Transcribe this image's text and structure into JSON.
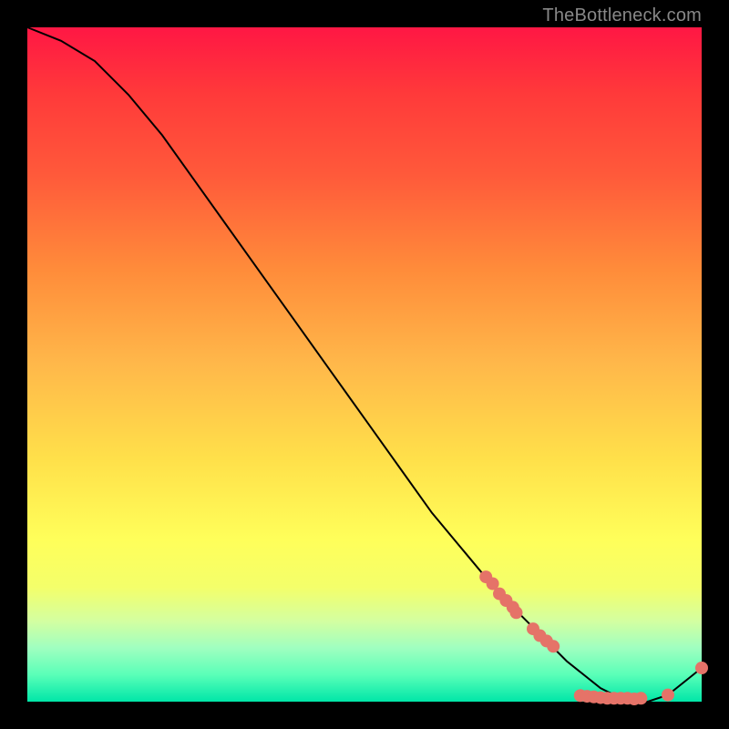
{
  "watermark": "TheBottleneck.com",
  "chart_data": {
    "type": "line",
    "title": "",
    "xlabel": "",
    "ylabel": "",
    "xlim": [
      0,
      100
    ],
    "ylim": [
      0,
      100
    ],
    "curve": {
      "name": "bottleneck-curve",
      "x": [
        0,
        5,
        10,
        15,
        20,
        25,
        30,
        35,
        40,
        45,
        50,
        55,
        60,
        65,
        70,
        75,
        80,
        85,
        88,
        90,
        92,
        95,
        100
      ],
      "y": [
        100,
        98,
        95,
        90,
        84,
        77,
        70,
        63,
        56,
        49,
        42,
        35,
        28,
        22,
        16,
        11,
        6,
        2,
        0.5,
        0,
        0,
        1,
        5
      ]
    },
    "markers": [
      {
        "x": 68,
        "y": 18.5
      },
      {
        "x": 69,
        "y": 17.5
      },
      {
        "x": 70,
        "y": 16
      },
      {
        "x": 71,
        "y": 15
      },
      {
        "x": 72,
        "y": 14
      },
      {
        "x": 72.5,
        "y": 13.2
      },
      {
        "x": 75,
        "y": 10.8
      },
      {
        "x": 76,
        "y": 9.8
      },
      {
        "x": 77,
        "y": 9
      },
      {
        "x": 78,
        "y": 8.2
      },
      {
        "x": 82,
        "y": 0.9
      },
      {
        "x": 83,
        "y": 0.8
      },
      {
        "x": 84,
        "y": 0.7
      },
      {
        "x": 85,
        "y": 0.6
      },
      {
        "x": 86,
        "y": 0.5
      },
      {
        "x": 87,
        "y": 0.5
      },
      {
        "x": 88,
        "y": 0.5
      },
      {
        "x": 89,
        "y": 0.5
      },
      {
        "x": 90,
        "y": 0.4
      },
      {
        "x": 91,
        "y": 0.5
      },
      {
        "x": 95,
        "y": 1.0
      },
      {
        "x": 100,
        "y": 5.0
      }
    ],
    "style": {
      "line_color": "#000000",
      "line_width": 2,
      "marker_color": "#e57368",
      "marker_radius": 7
    }
  }
}
